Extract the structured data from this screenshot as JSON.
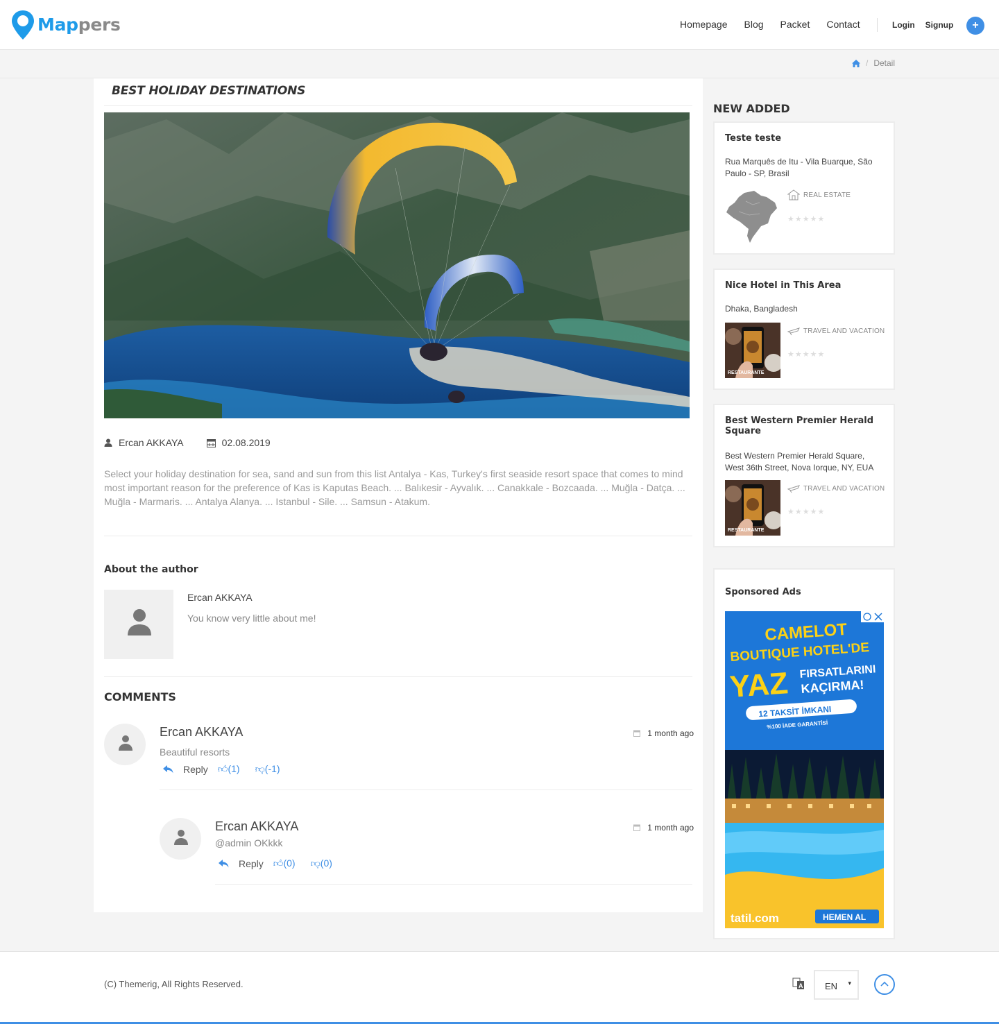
{
  "brand": {
    "part1": "Map",
    "part2": "pers",
    "accent": "#1e9be9"
  },
  "nav": {
    "items": [
      "Homepage",
      "Blog",
      "Packet",
      "Contact"
    ],
    "login": "Login",
    "signup": "Signup",
    "add_button": "+"
  },
  "breadcrumb": {
    "home_icon": "home-icon",
    "separator": "/",
    "current": "Detail"
  },
  "post": {
    "title": "BEST HOLIDAY DESTINATIONS",
    "author": "Ercan AKKAYA",
    "date": "02.08.2019",
    "body": "Select your holiday destination for sea, sand and sun from this list Antalya - Kas, Turkey's first seaside resort space that comes to mind most important reason for the preference of Kas is Kaputas Beach. ... Balıkesir - Ayvalık. ... Canakkale - Bozcaada. ... Muğla - Datça. ... Muğla - Marmaris. ... Antalya Alanya. ... Istanbul - Sile. ... Samsun - Atakum."
  },
  "about": {
    "heading": "About the author",
    "name": "Ercan AKKAYA",
    "bio": "You know very little about me!"
  },
  "comments": {
    "heading": "COMMENTS",
    "items": [
      {
        "name": "Ercan AKKAYA",
        "time": "1 month ago",
        "text": "Beautiful resorts",
        "reply": "Reply",
        "likes": "(1)",
        "dislikes": "(-1)"
      },
      {
        "name": "Ercan AKKAYA",
        "time": "1 month ago",
        "text": "@admin OKkkk",
        "reply": "Reply",
        "likes": "(0)",
        "dislikes": "(0)"
      }
    ]
  },
  "sidebar": {
    "heading": "NEW ADDED",
    "listings": [
      {
        "title": "Teste teste",
        "address": "Rua Marquês de Itu - Vila Buarque, São Paulo - SP, Brasil",
        "category": "REAL ESTATE",
        "stars": "★★★★★"
      },
      {
        "title": "Nice Hotel in This Area",
        "address": "Dhaka, Bangladesh",
        "category": "TRAVEL AND VACATION",
        "stars": "★★★★★",
        "thumb_label": "RESTAURANTE"
      },
      {
        "title": "Best Western Premier Herald Square",
        "address": "Best Western Premier Herald Square, West 36th Street, Nova Iorque, NY, EUA",
        "category": "TRAVEL AND VACATION",
        "stars": "★★★★★",
        "thumb_label": "RESTAURANTE"
      }
    ],
    "ads": {
      "title": "Sponsored Ads",
      "line1": "CAMELOT",
      "line2": "BOUTIQUE HOTEL'DE",
      "line3": "YAZ",
      "line4": "FIRSATLARINI",
      "line5": "KAÇIRMA!",
      "line6": "12 TAKSİT İMKANI",
      "line7": "%100 İADE GARANTİSİ",
      "brand": "tatil.com",
      "cta": "HEMEN AL"
    }
  },
  "footer": {
    "copyright": "(C) Themerig, All Rights Reserved.",
    "language": "EN",
    "caret": "▾"
  }
}
